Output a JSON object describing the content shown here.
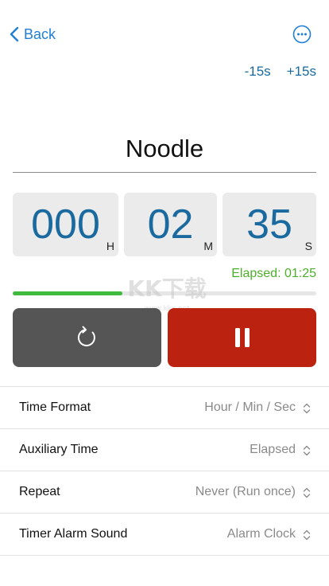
{
  "nav": {
    "back_label": "Back",
    "back_icon": "chevron-left-icon",
    "more_icon": "more-circle-icon"
  },
  "adjust": {
    "minus_label": "-15s",
    "plus_label": "+15s"
  },
  "timer": {
    "name": "Noodle",
    "hours": "000",
    "hours_unit": "H",
    "minutes": "02",
    "minutes_unit": "M",
    "seconds": "35",
    "seconds_unit": "S",
    "elapsed": "Elapsed: 01:25",
    "progress_fraction": 0.36
  },
  "watermark": {
    "text": "KK下载"
  },
  "controls": {
    "reset_icon": "restart-icon",
    "pause_icon": "pause-icon"
  },
  "settings": [
    {
      "label": "Time Format",
      "value": "Hour / Min / Sec"
    },
    {
      "label": "Auxiliary Time",
      "value": "Elapsed"
    },
    {
      "label": "Repeat",
      "value": "Never (Run once)"
    },
    {
      "label": "Timer Alarm Sound",
      "value": "Alarm Clock"
    }
  ],
  "colors": {
    "accent_blue": "#1a6aa0",
    "link_blue": "#1f7fd6",
    "elapsed_green": "#4caf2a",
    "progress_green": "#3fba3c",
    "pause_red": "#bb2210",
    "reset_gray": "#555555",
    "box_gray": "#ebebeb"
  }
}
